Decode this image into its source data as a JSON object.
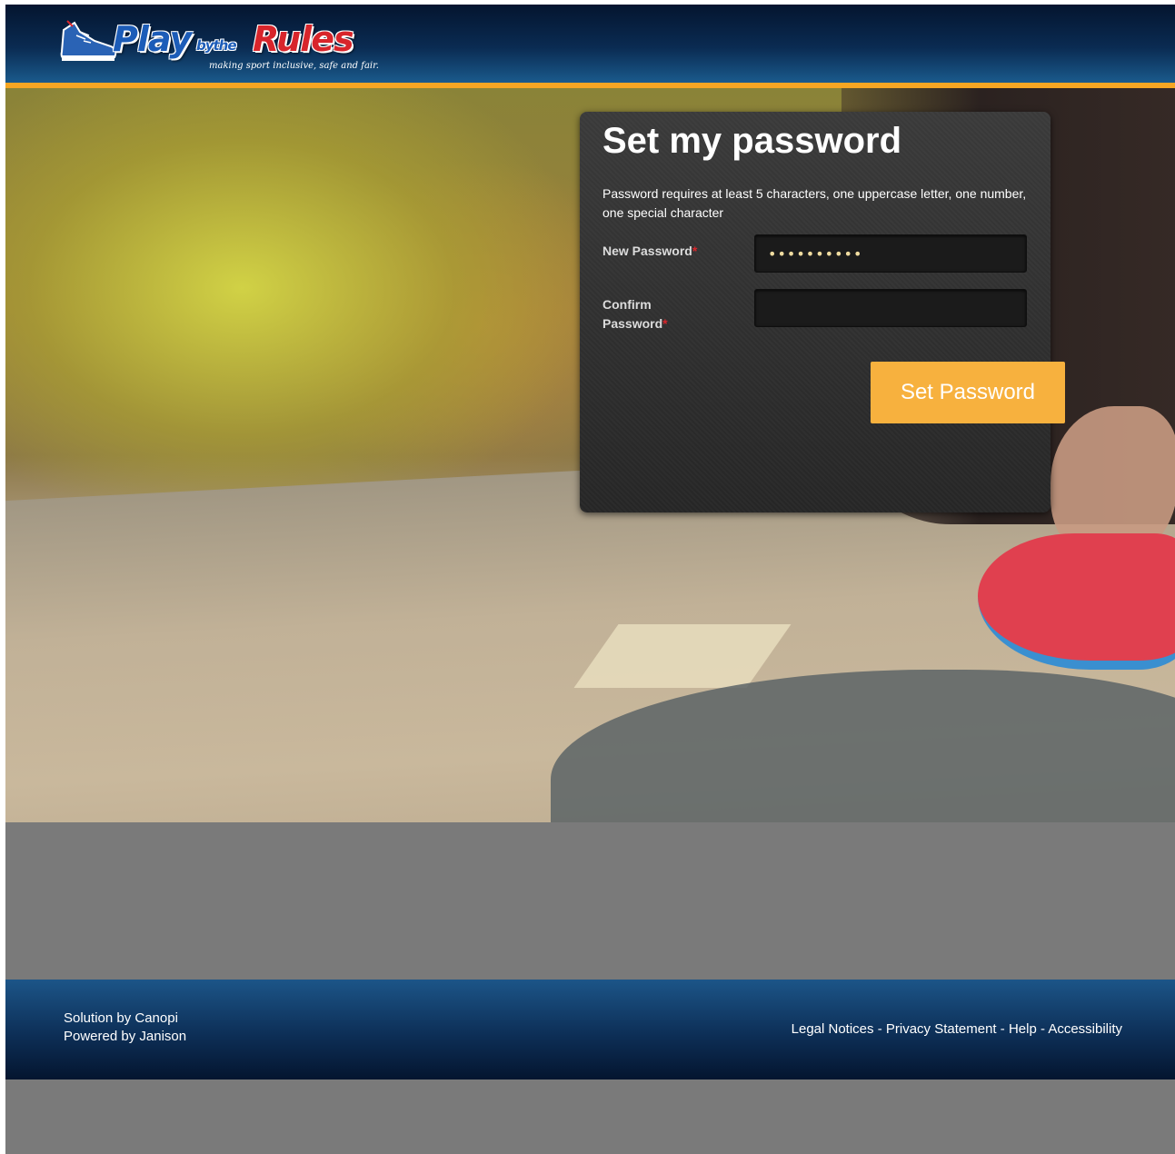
{
  "header": {
    "logo": {
      "word_play": "Play",
      "word_bythe": "bythe",
      "word_rules": "Rules",
      "tagline": "making sport inclusive, safe and fair.",
      "icon": "sneaker-icon"
    }
  },
  "card": {
    "title": "Set my password",
    "hint": "Password requires at least 5 characters, one uppercase letter, one number, one special character",
    "new_password": {
      "label": "New Password",
      "required_mark": "*",
      "value": "••••••••••"
    },
    "confirm_password": {
      "label": "Confirm Password",
      "required_mark": "*",
      "value": ""
    },
    "submit_label": "Set Password"
  },
  "footer": {
    "solution": "Solution by Canopi",
    "powered": "Powered by Janison",
    "links": {
      "legal": "Legal Notices",
      "privacy": "Privacy Statement",
      "help": "Help",
      "accessibility": "Accessibility",
      "separator": " - "
    }
  },
  "colors": {
    "accent": "#f6a623",
    "button": "#f7b13e",
    "header_dark": "#04152f",
    "header_light": "#1a5a8c",
    "card_bg": "#2e2e2e",
    "page_bg": "#7a7a7a",
    "required": "#d8252b"
  }
}
